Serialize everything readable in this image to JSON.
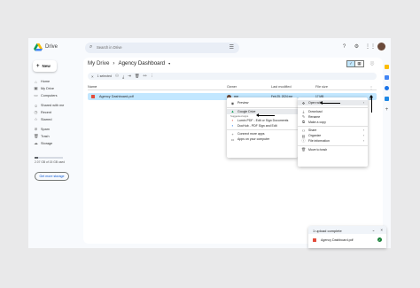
{
  "app": {
    "brand": "Drive"
  },
  "search": {
    "placeholder": "Search in Drive"
  },
  "topbar_icons": [
    "help-icon",
    "settings-icon",
    "apps-icon"
  ],
  "sidebar": {
    "new_label": "New",
    "items": [
      {
        "label": "Home",
        "icon": "home-icon"
      },
      {
        "label": "My Drive",
        "icon": "drive-icon"
      },
      {
        "label": "Computers",
        "icon": "computer-icon"
      },
      {
        "label": "Shared with me",
        "icon": "shared-icon"
      },
      {
        "label": "Recent",
        "icon": "clock-icon"
      },
      {
        "label": "Starred",
        "icon": "star-icon"
      },
      {
        "label": "Spam",
        "icon": "spam-icon"
      },
      {
        "label": "Trash",
        "icon": "trash-icon"
      },
      {
        "label": "Storage",
        "icon": "cloud-icon"
      }
    ],
    "storage_text": "2.07 GB of 15 GB used",
    "storage_fraction": 0.14,
    "get_more_label": "Get more storage"
  },
  "breadcrumb": {
    "root": "My Drive",
    "current": "Agency Dashboard",
    "sep": "›",
    "caret": "▾"
  },
  "selection": {
    "count_label": "1 selected"
  },
  "table": {
    "headers": {
      "name": "Name",
      "owner": "Owner",
      "modified": "Last modified",
      "size": "File size"
    },
    "row": {
      "name": "Agency Dashboard.pdf",
      "owner": "me",
      "modified": "Feb 25, 2024 me",
      "size": "17 MB"
    }
  },
  "context_menu": {
    "preview": "Preview",
    "open_with": "Open with",
    "download": "Download",
    "rename": "Rename",
    "make_copy": "Make a copy",
    "share": "Share",
    "organize": "Organize",
    "file_info": "File information",
    "move_trash": "Move to trash"
  },
  "open_with_menu": {
    "google_drive": "Google Drive",
    "suggested_header": "Suggested apps",
    "app1": "Lumin PDF - Edit or Sign Documents",
    "app2": "DocHub - PDF Sign and Edit",
    "connect": "Connect more apps",
    "computer_apps": "Apps on your computer"
  },
  "upload": {
    "title": "1 upload complete",
    "file": "Agency Dashboard.pdf"
  },
  "colors": {
    "accent": "#0b57d0",
    "selected_row": "#c2e7ff",
    "pdf_red": "#e34c3b",
    "success": "#188038"
  }
}
